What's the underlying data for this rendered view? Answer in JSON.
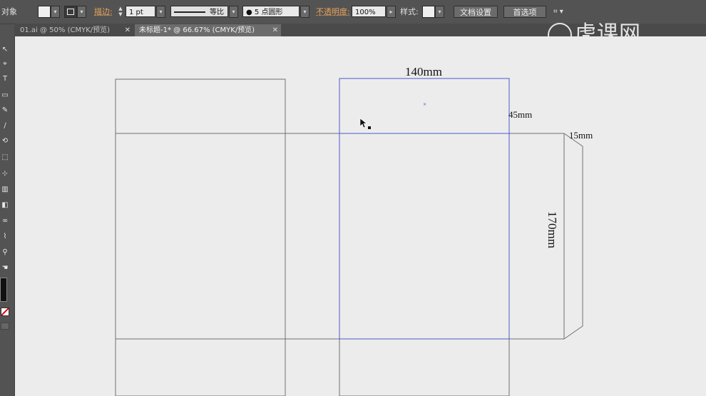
{
  "control_bar": {
    "object_label": "对象",
    "stroke_label": "描边:",
    "stroke_weight": "1 pt",
    "stroke_profile": "等比",
    "brush": "5 点圆形",
    "opacity_label": "不透明度:",
    "opacity_value": "100%",
    "style_label": "样式:",
    "doc_setup_button": "文档设置",
    "preferences_button": "首选项"
  },
  "tabs": [
    {
      "label": "01.ai @ 50% (CMYK/预览)",
      "active": false
    },
    {
      "label": "未标题-1* @ 66.67% (CMYK/预览)",
      "active": true
    }
  ],
  "watermark": "虎课网",
  "dimensions": {
    "width_label": "140mm",
    "flap_label": "45mm",
    "side_label": "15mm",
    "height_label": "170mm"
  },
  "colors": {
    "canvas": "#ececec",
    "outline": "#707070",
    "selection": "#4a5ad0",
    "ui_bg": "#535353"
  },
  "icons": [
    "selection-arrow-icon",
    "direct-select-icon",
    "pen-icon",
    "type-icon",
    "rectangle-icon",
    "pencil-icon",
    "brush-icon",
    "rotate-icon",
    "scale-icon",
    "free-transform-icon",
    "graph-icon",
    "gradient-icon",
    "eyedropper-icon",
    "blend-icon",
    "zoom-icon",
    "hand-icon",
    "fill-stroke-icon",
    "none-swatch-icon",
    "screen-mode-icon"
  ]
}
